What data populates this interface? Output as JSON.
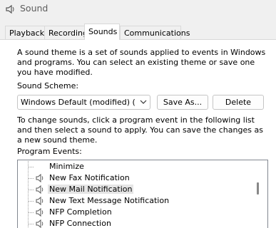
{
  "window": {
    "title": "Sound",
    "icon": "speaker-icon"
  },
  "tabs": [
    {
      "label": "Playback",
      "active": false
    },
    {
      "label": "Recording",
      "active": false
    },
    {
      "label": "Sounds",
      "active": true
    },
    {
      "label": "Communications",
      "active": false
    }
  ],
  "sounds": {
    "theme_description": "A sound theme is a set of sounds applied to events in Windows and programs. You can select an existing theme or save one you have modified.",
    "scheme_label": "Sound Scheme:",
    "scheme_value": "Windows Default (modified) (mc",
    "save_as_label": "Save As...",
    "delete_label": "Delete",
    "events_description": "To change sounds, click a program event in the following list and then select a sound to apply. You can save the changes as a new sound theme.",
    "events_label": "Program Events:",
    "events": [
      {
        "label": "Minimize",
        "has_sound": false,
        "selected": false
      },
      {
        "label": "New Fax Notification",
        "has_sound": true,
        "selected": false
      },
      {
        "label": "New Mail Notification",
        "has_sound": true,
        "selected": true
      },
      {
        "label": "New Text Message Notification",
        "has_sound": true,
        "selected": false
      },
      {
        "label": "NFP Completion",
        "has_sound": true,
        "selected": false
      },
      {
        "label": "NFP Connection",
        "has_sound": true,
        "selected": false
      }
    ]
  }
}
